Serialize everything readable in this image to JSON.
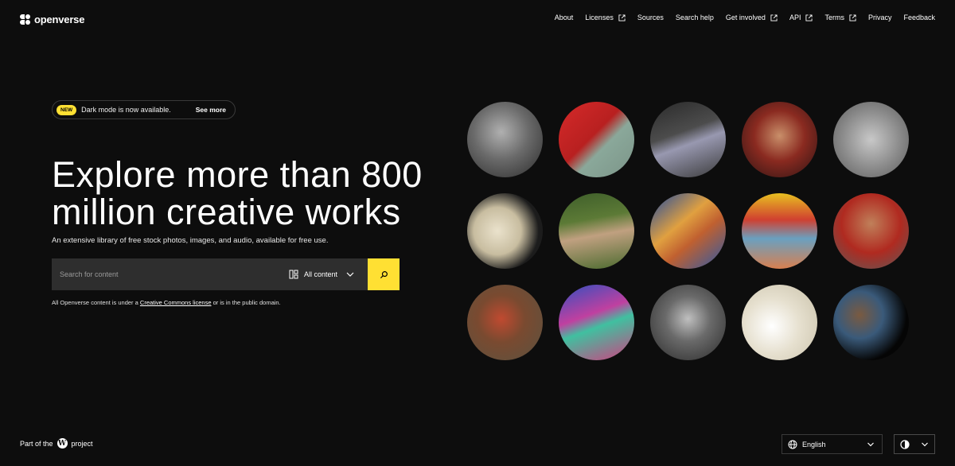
{
  "header": {
    "logo_text": "openverse",
    "nav": [
      {
        "label": "About",
        "external": false
      },
      {
        "label": "Licenses",
        "external": true
      },
      {
        "label": "Sources",
        "external": false
      },
      {
        "label": "Search help",
        "external": false
      },
      {
        "label": "Get involved",
        "external": true
      },
      {
        "label": "API",
        "external": true
      },
      {
        "label": "Terms",
        "external": true
      },
      {
        "label": "Privacy",
        "external": false
      },
      {
        "label": "Feedback",
        "external": false
      }
    ]
  },
  "announcement": {
    "badge": "NEW",
    "message": "Dark mode is now available.",
    "link": "See more"
  },
  "hero": {
    "headline": "Explore more than 800 million creative works",
    "subline": "An extensive library of free stock photos, images, and audio, available for free use."
  },
  "search": {
    "placeholder": "Search for content",
    "content_type": "All content"
  },
  "license_note": {
    "prefix": "All Openverse content is under a ",
    "link": "Creative Commons license",
    "suffix": " or is in the public domain."
  },
  "footer": {
    "part_of_prefix": "Part of the",
    "part_of_suffix": "project",
    "language": "English"
  },
  "colors": {
    "background": "#0d0d0d",
    "accent": "#ffe033",
    "search_bg": "#2e2e2e"
  }
}
